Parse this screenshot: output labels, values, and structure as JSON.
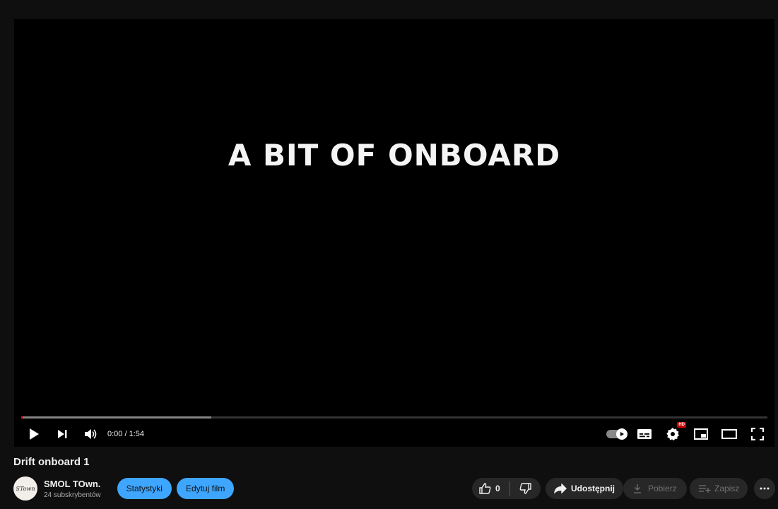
{
  "player": {
    "overlay_text": "A BIT OF ONBOARD",
    "time_display": "0:00 / 1:54",
    "progress_played_fraction": 0.0,
    "progress_buffered_fraction": 0.255,
    "hd_badge": "HD"
  },
  "video": {
    "title": "Drift onboard 1"
  },
  "channel": {
    "name": "SMOL TOwn.",
    "subscribers": "24 subskrybentów",
    "avatar_text": "STown"
  },
  "actions": {
    "stats_label": "Statystyki",
    "edit_label": "Edytuj film",
    "like_count": "0",
    "share_label": "Udostępnij",
    "download_label": "Pobierz",
    "save_label": "Zapisz"
  },
  "colors": {
    "background": "#0f0f0f",
    "accent_blue": "#3ea6ff",
    "progress_red": "#ff0000",
    "pill_dark": "#272727"
  }
}
